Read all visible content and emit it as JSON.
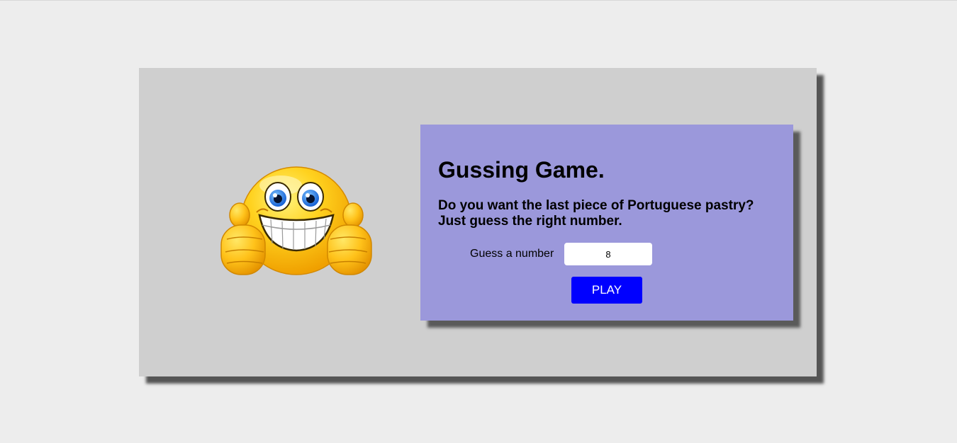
{
  "game": {
    "title": "Gussing Game.",
    "prompt_line1": "Do you want the last piece of Portuguese pastry?",
    "prompt_line2": "Just guess the right number.",
    "guess_label": "Guess a number",
    "guess_value": "8",
    "play_label": "PLAY"
  },
  "image": {
    "icon": "smiley-thumbs-up-icon"
  },
  "colors": {
    "page_background": "#ededed",
    "card_background": "#cfcfcf",
    "panel_background": "#9b98db",
    "play_button": "#0000ff",
    "play_text": "#ffffff"
  }
}
